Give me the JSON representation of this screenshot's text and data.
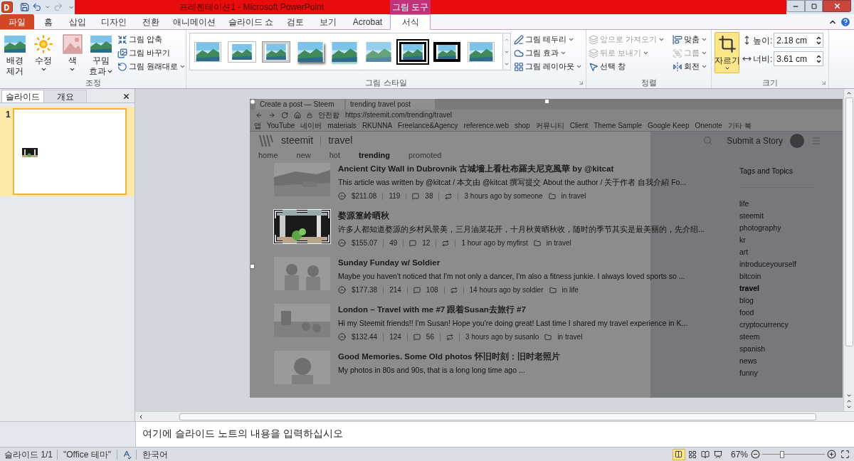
{
  "window": {
    "title": "프레젠테이션1 - Microsoft PowerPoint",
    "context_tab": "그림 도구"
  },
  "tabs": [
    {
      "label": "파일",
      "kind": "file",
      "selected": false
    },
    {
      "label": "홈",
      "kind": "tab",
      "selected": false
    },
    {
      "label": "삽입",
      "kind": "tab",
      "selected": false
    },
    {
      "label": "디자인",
      "kind": "tab",
      "selected": false
    },
    {
      "label": "전환",
      "kind": "tab",
      "selected": false
    },
    {
      "label": "애니메이션",
      "kind": "tab",
      "selected": false
    },
    {
      "label": "슬라이드 쇼",
      "kind": "tab",
      "selected": false
    },
    {
      "label": "검토",
      "kind": "tab",
      "selected": false
    },
    {
      "label": "보기",
      "kind": "tab",
      "selected": false
    },
    {
      "label": "Acrobat",
      "kind": "tab",
      "selected": false
    },
    {
      "label": "서식",
      "kind": "tab",
      "selected": true
    }
  ],
  "ribbon": {
    "adjust": {
      "label": "조정",
      "large_buttons": [
        {
          "lines": [
            "배경",
            "제거"
          ],
          "dropdown": false
        },
        {
          "lines": [
            "수정"
          ],
          "dropdown": true
        },
        {
          "lines": [
            "색"
          ],
          "dropdown": true
        },
        {
          "lines": [
            "꾸밈",
            "효과"
          ],
          "dropdown": true
        }
      ],
      "small_buttons": [
        {
          "label": "그림 압축",
          "dropdown": false
        },
        {
          "label": "그림 바꾸기",
          "dropdown": false
        },
        {
          "label": "그림 원래대로",
          "dropdown": true
        }
      ]
    },
    "styles": {
      "label": "그림 스타일",
      "gallery": [
        {
          "kind": "plain"
        },
        {
          "kind": "white-frame"
        },
        {
          "kind": "gray-frame"
        },
        {
          "kind": "shadow"
        },
        {
          "kind": "reflect"
        },
        {
          "kind": "soft"
        },
        {
          "kind": "double-black"
        },
        {
          "kind": "black"
        },
        {
          "kind": "plain"
        }
      ],
      "small_buttons": [
        {
          "label": "그림 테두리",
          "dropdown": true
        },
        {
          "label": "그림 효과",
          "dropdown": true
        },
        {
          "label": "그림 레이아웃",
          "dropdown": true
        }
      ]
    },
    "arrange": {
      "label": "정렬",
      "buttons": [
        {
          "label": "앞으로 가져오기",
          "dropdown": true,
          "disabled": true
        },
        {
          "label": "맞춤",
          "dropdown": true,
          "disabled": false
        },
        {
          "label": "뒤로 보내기",
          "dropdown": true,
          "disabled": true
        },
        {
          "label": "그룹",
          "dropdown": true,
          "disabled": true
        },
        {
          "label": "선택 창",
          "dropdown": false,
          "disabled": false
        },
        {
          "label": "회전",
          "dropdown": true,
          "disabled": false
        }
      ]
    },
    "size": {
      "label": "크기",
      "crop": {
        "label": "자르기",
        "selected": true
      },
      "fields": [
        {
          "label": "높이:",
          "value": "2.18 cm"
        },
        {
          "label": "너비:",
          "value": "3.61 cm"
        }
      ]
    }
  },
  "side_panel": {
    "tabs": [
      {
        "label": "슬라이드",
        "selected": true
      },
      {
        "label": "개요",
        "selected": false
      }
    ],
    "slides": [
      {
        "number": "1",
        "selected": true
      }
    ]
  },
  "webpage": {
    "browser_tabs": [
      "Create a post — Steem",
      "trending travel post"
    ],
    "security": "안전함",
    "url": "https://steemit.com/trending/travel",
    "bookmarks": [
      "앱",
      "YouTube",
      "네이버",
      "materials",
      "RKUNNA",
      "Freelance&Agency",
      "reference.web",
      "shop",
      "커뮤니티",
      "Client",
      "Theme Sample",
      "Google Keep",
      "Onenote",
      "기타 북"
    ],
    "brand": "steemit",
    "section": "travel",
    "submit": "Submit a Story",
    "nav": [
      {
        "label": "home",
        "selected": false
      },
      {
        "label": "new",
        "selected": false
      },
      {
        "label": "hot",
        "selected": false
      },
      {
        "label": "trending",
        "selected": true
      },
      {
        "label": "promoted",
        "selected": false
      }
    ],
    "posts": [
      {
        "title": "Ancient City Wall in Dubrovnik 古城墻上看杜布羅夫尼克風華 by @kitcat",
        "excerpt": "This article was written by @kitcat / 本文由 @kitcat 撰写提交 About the author / 关于作者 自我介紹 Fo...",
        "payout": "$211.08",
        "votes": "119",
        "comments": "38",
        "time": "3 hours ago by someone",
        "category": "in travel",
        "cropped": false
      },
      {
        "title": "婺源篁岭晒秋",
        "excerpt": "许多人都知道婺源的乡村风景美，三月油菜花开，十月秋黄晒秋收，随时的季节其实是最美丽的，先介绍...",
        "payout": "$155.07",
        "votes": "49",
        "comments": "12",
        "time": "1 hour ago by myfirst",
        "category": "in travel",
        "cropped": true
      },
      {
        "title": "Sunday Funday w/ Soldier",
        "excerpt": "Maybe you haven't noticed that I'm not only a dancer, I'm also a fitness junkie. I always loved sports so ...",
        "payout": "$177.38",
        "votes": "214",
        "comments": "108",
        "time": "14 hours ago by soldier",
        "category": "in life",
        "cropped": false
      },
      {
        "title": "London – Travel with me #7 跟着Susan去旅行 #7",
        "excerpt": "Hi my Steemit friends!! I'm Susan! Hope you're doing great! Last time I shared my travel experience in K...",
        "payout": "$132.44",
        "votes": "124",
        "comments": "56",
        "time": "3 hours ago by susanlo",
        "category": "in travel",
        "cropped": false
      },
      {
        "title": "Good Memories. Some Old photos 怀旧时刻：旧时老照片",
        "excerpt": "My photos in 80s and 90s, that is a long long time ago ...",
        "cropped": false
      }
    ],
    "tags_title": "Tags and Topics",
    "tags": [
      {
        "label": "life",
        "selected": false
      },
      {
        "label": "steemit",
        "selected": false
      },
      {
        "label": "photography",
        "selected": false
      },
      {
        "label": "kr",
        "selected": false
      },
      {
        "label": "art",
        "selected": false
      },
      {
        "label": "introduceyourself",
        "selected": false
      },
      {
        "label": "bitcoin",
        "selected": false
      },
      {
        "label": "travel",
        "selected": true
      },
      {
        "label": "blog",
        "selected": false
      },
      {
        "label": "food",
        "selected": false
      },
      {
        "label": "cryptocurrency",
        "selected": false
      },
      {
        "label": "steem",
        "selected": false
      },
      {
        "label": "spanish",
        "selected": false
      },
      {
        "label": "news",
        "selected": false
      },
      {
        "label": "funny",
        "selected": false
      }
    ]
  },
  "notes": {
    "placeholder": "여기에 슬라이드 노트의 내용을 입력하십시오"
  },
  "status_bar": {
    "slide": "슬라이드 1/1",
    "theme": "\"Office 테마\"",
    "language": "한국어",
    "zoom": "67%",
    "zoom_slider": {
      "level": 0.32
    }
  }
}
